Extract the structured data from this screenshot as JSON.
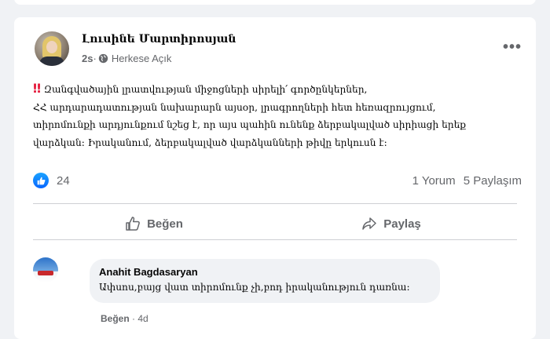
{
  "post": {
    "author": "Լուսինե Մարտիրոսյան",
    "time": "2s",
    "separator": " · ",
    "audience": "Herkese Açık",
    "more": "•••",
    "text_lines": [
      "Զանգվածային լրատվության միջոցների սիրելի՛ գործընկերներ,",
      "ՀՀ արդարադատության նախարարն այսօր, լրագրողների հետ հեռազրույցում,",
      "տիրոմունքի արդյունքում նշեց է, որ այս պահին ունենք ձերբակալված սիրիացի երեք",
      "վարձկան: Իրականում, ձերբակալված վարձկանների թիվը երկուսն է:"
    ],
    "alert_icon": "‼"
  },
  "reactions": {
    "like_icon": "thumbs-up-icon",
    "count": "24"
  },
  "stats": {
    "comments": "1 Yorum",
    "shares": "5 Paylaşım"
  },
  "actions": {
    "like_label": "Beğen",
    "share_label": "Paylaş"
  },
  "comment": {
    "author": "Anahit Bagdasaryan",
    "text": "Ափսոս,բայց վատ տիրոմունք չի,բոդ իրականություն դառնա:",
    "like_label": "Beğen",
    "time": " · 4d"
  },
  "colors": {
    "background": "#f0f2f5",
    "card": "#ffffff",
    "accent": "#0866ff",
    "secondary_text": "#65676b",
    "alert": "#e4193a"
  }
}
